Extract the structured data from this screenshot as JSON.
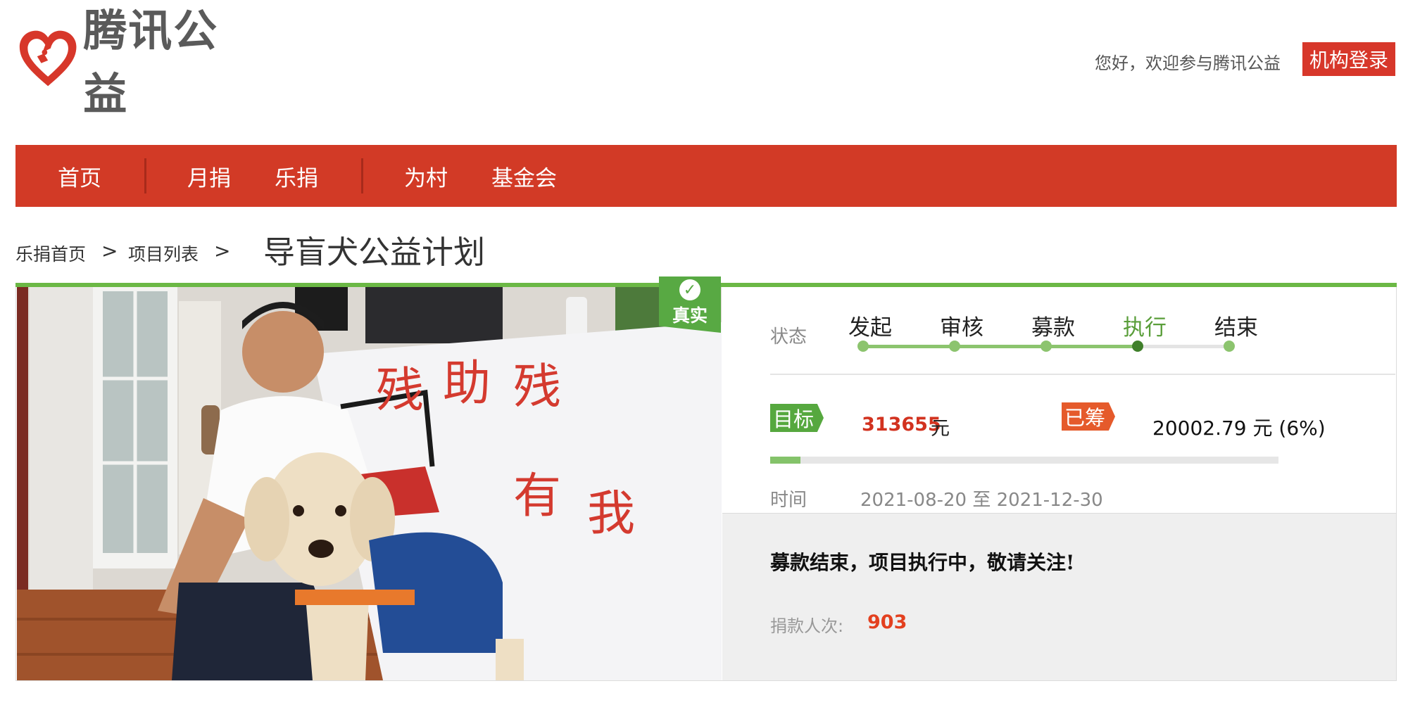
{
  "header": {
    "logo_text": "腾讯公益",
    "greeting": "您好，欢迎参与腾讯公益",
    "login_label": "机构登录",
    "brand_color": "#d23a26"
  },
  "nav": {
    "items": [
      "首页",
      "月捐",
      "乐捐",
      "为村",
      "基金会"
    ]
  },
  "breadcrumb": {
    "home": "乐捐首页",
    "list": "项目列表",
    "separator": ">",
    "title": "导盲犬公益计划"
  },
  "photo": {
    "badge_text": "真实",
    "sign_text": [
      "残",
      "助",
      "残",
      "有",
      "我"
    ]
  },
  "status": {
    "label": "状态",
    "steps": [
      "发起",
      "审核",
      "募款",
      "执行",
      "结束"
    ],
    "current_step_index": 3,
    "active_color": "#5a9e3a"
  },
  "funding": {
    "target_tag": "目标",
    "target_value": "313655",
    "unit": "元",
    "raised_tag": "已筹",
    "raised_value": "20002.79 元 (6%)",
    "progress_fraction": 0.06
  },
  "time": {
    "label": "时间",
    "range": "2021-08-20 至 2021-12-30"
  },
  "notice": {
    "text": "募款结束，项目执行中，敬请关注!",
    "donors_label": "捐款人次:",
    "donors_value": "903"
  }
}
